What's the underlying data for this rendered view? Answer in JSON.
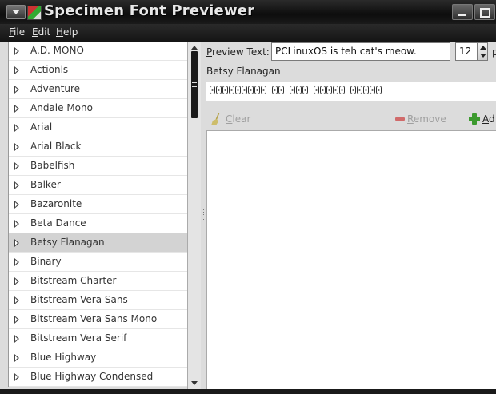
{
  "window": {
    "title": "Specimen Font Previewer"
  },
  "menubar": {
    "items": [
      {
        "label": "File",
        "accel": "F",
        "rest": "ile"
      },
      {
        "label": "Edit",
        "accel": "E",
        "rest": "dit"
      },
      {
        "label": "Help",
        "accel": "H",
        "rest": "elp"
      }
    ]
  },
  "font_list": {
    "items": [
      "A.D. MONO",
      "Actionls",
      "Adventure",
      "Andale Mono",
      "Arial",
      "Arial Black",
      "Babelfish",
      "Balker",
      "Bazaronite",
      "Beta Dance",
      "Betsy Flanagan",
      "Binary",
      "Bitstream Charter",
      "Bitstream Vera Sans",
      "Bitstream Vera Sans Mono",
      "Bitstream Vera Serif",
      "Blue Highway",
      "Blue Highway Condensed"
    ],
    "selected": "Betsy Flanagan"
  },
  "preview": {
    "label_accel": "P",
    "label_rest": "review Text:",
    "text_value": "PCLinuxOS is teh cat's meow.",
    "size_value": "12",
    "size_unit_partial": "p",
    "font_name": "Betsy Flanagan"
  },
  "toolbar": {
    "clear_accel": "C",
    "clear_rest": "lear",
    "remove_accel": "R",
    "remove_rest": "emove",
    "add_accel": "A",
    "add_rest": "d"
  },
  "colors": {
    "titlebar": "#1a1a1a",
    "selection": "#d3d3d3",
    "add_icon": "#3c9a2e",
    "remove_icon": "#d06a6a"
  }
}
